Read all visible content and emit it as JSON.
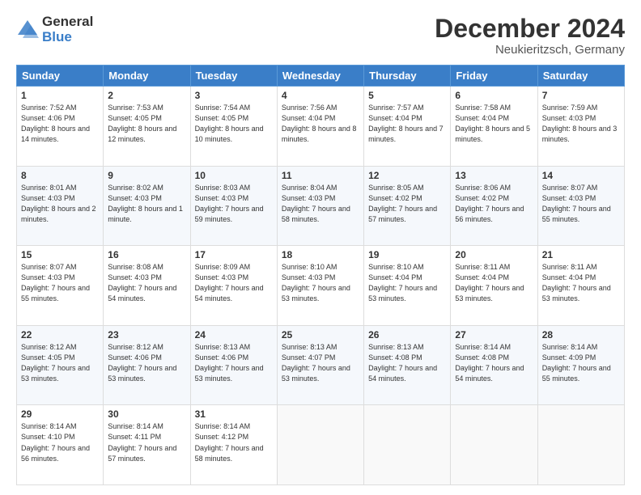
{
  "logo": {
    "general": "General",
    "blue": "Blue"
  },
  "header": {
    "month": "December 2024",
    "location": "Neukieritzsch, Germany"
  },
  "weekdays": [
    "Sunday",
    "Monday",
    "Tuesday",
    "Wednesday",
    "Thursday",
    "Friday",
    "Saturday"
  ],
  "weeks": [
    [
      {
        "day": "1",
        "sunrise": "7:52 AM",
        "sunset": "4:06 PM",
        "daylight": "8 hours and 14 minutes."
      },
      {
        "day": "2",
        "sunrise": "7:53 AM",
        "sunset": "4:05 PM",
        "daylight": "8 hours and 12 minutes."
      },
      {
        "day": "3",
        "sunrise": "7:54 AM",
        "sunset": "4:05 PM",
        "daylight": "8 hours and 10 minutes."
      },
      {
        "day": "4",
        "sunrise": "7:56 AM",
        "sunset": "4:04 PM",
        "daylight": "8 hours and 8 minutes."
      },
      {
        "day": "5",
        "sunrise": "7:57 AM",
        "sunset": "4:04 PM",
        "daylight": "8 hours and 7 minutes."
      },
      {
        "day": "6",
        "sunrise": "7:58 AM",
        "sunset": "4:04 PM",
        "daylight": "8 hours and 5 minutes."
      },
      {
        "day": "7",
        "sunrise": "7:59 AM",
        "sunset": "4:03 PM",
        "daylight": "8 hours and 3 minutes."
      }
    ],
    [
      {
        "day": "8",
        "sunrise": "8:01 AM",
        "sunset": "4:03 PM",
        "daylight": "8 hours and 2 minutes."
      },
      {
        "day": "9",
        "sunrise": "8:02 AM",
        "sunset": "4:03 PM",
        "daylight": "8 hours and 1 minute."
      },
      {
        "day": "10",
        "sunrise": "8:03 AM",
        "sunset": "4:03 PM",
        "daylight": "7 hours and 59 minutes."
      },
      {
        "day": "11",
        "sunrise": "8:04 AM",
        "sunset": "4:03 PM",
        "daylight": "7 hours and 58 minutes."
      },
      {
        "day": "12",
        "sunrise": "8:05 AM",
        "sunset": "4:02 PM",
        "daylight": "7 hours and 57 minutes."
      },
      {
        "day": "13",
        "sunrise": "8:06 AM",
        "sunset": "4:02 PM",
        "daylight": "7 hours and 56 minutes."
      },
      {
        "day": "14",
        "sunrise": "8:07 AM",
        "sunset": "4:03 PM",
        "daylight": "7 hours and 55 minutes."
      }
    ],
    [
      {
        "day": "15",
        "sunrise": "8:07 AM",
        "sunset": "4:03 PM",
        "daylight": "7 hours and 55 minutes."
      },
      {
        "day": "16",
        "sunrise": "8:08 AM",
        "sunset": "4:03 PM",
        "daylight": "7 hours and 54 minutes."
      },
      {
        "day": "17",
        "sunrise": "8:09 AM",
        "sunset": "4:03 PM",
        "daylight": "7 hours and 54 minutes."
      },
      {
        "day": "18",
        "sunrise": "8:10 AM",
        "sunset": "4:03 PM",
        "daylight": "7 hours and 53 minutes."
      },
      {
        "day": "19",
        "sunrise": "8:10 AM",
        "sunset": "4:04 PM",
        "daylight": "7 hours and 53 minutes."
      },
      {
        "day": "20",
        "sunrise": "8:11 AM",
        "sunset": "4:04 PM",
        "daylight": "7 hours and 53 minutes."
      },
      {
        "day": "21",
        "sunrise": "8:11 AM",
        "sunset": "4:04 PM",
        "daylight": "7 hours and 53 minutes."
      }
    ],
    [
      {
        "day": "22",
        "sunrise": "8:12 AM",
        "sunset": "4:05 PM",
        "daylight": "7 hours and 53 minutes."
      },
      {
        "day": "23",
        "sunrise": "8:12 AM",
        "sunset": "4:06 PM",
        "daylight": "7 hours and 53 minutes."
      },
      {
        "day": "24",
        "sunrise": "8:13 AM",
        "sunset": "4:06 PM",
        "daylight": "7 hours and 53 minutes."
      },
      {
        "day": "25",
        "sunrise": "8:13 AM",
        "sunset": "4:07 PM",
        "daylight": "7 hours and 53 minutes."
      },
      {
        "day": "26",
        "sunrise": "8:13 AM",
        "sunset": "4:08 PM",
        "daylight": "7 hours and 54 minutes."
      },
      {
        "day": "27",
        "sunrise": "8:14 AM",
        "sunset": "4:08 PM",
        "daylight": "7 hours and 54 minutes."
      },
      {
        "day": "28",
        "sunrise": "8:14 AM",
        "sunset": "4:09 PM",
        "daylight": "7 hours and 55 minutes."
      }
    ],
    [
      {
        "day": "29",
        "sunrise": "8:14 AM",
        "sunset": "4:10 PM",
        "daylight": "7 hours and 56 minutes."
      },
      {
        "day": "30",
        "sunrise": "8:14 AM",
        "sunset": "4:11 PM",
        "daylight": "7 hours and 57 minutes."
      },
      {
        "day": "31",
        "sunrise": "8:14 AM",
        "sunset": "4:12 PM",
        "daylight": "7 hours and 58 minutes."
      },
      null,
      null,
      null,
      null
    ]
  ],
  "labels": {
    "sunrise": "Sunrise:",
    "sunset": "Sunset:",
    "daylight": "Daylight:"
  }
}
